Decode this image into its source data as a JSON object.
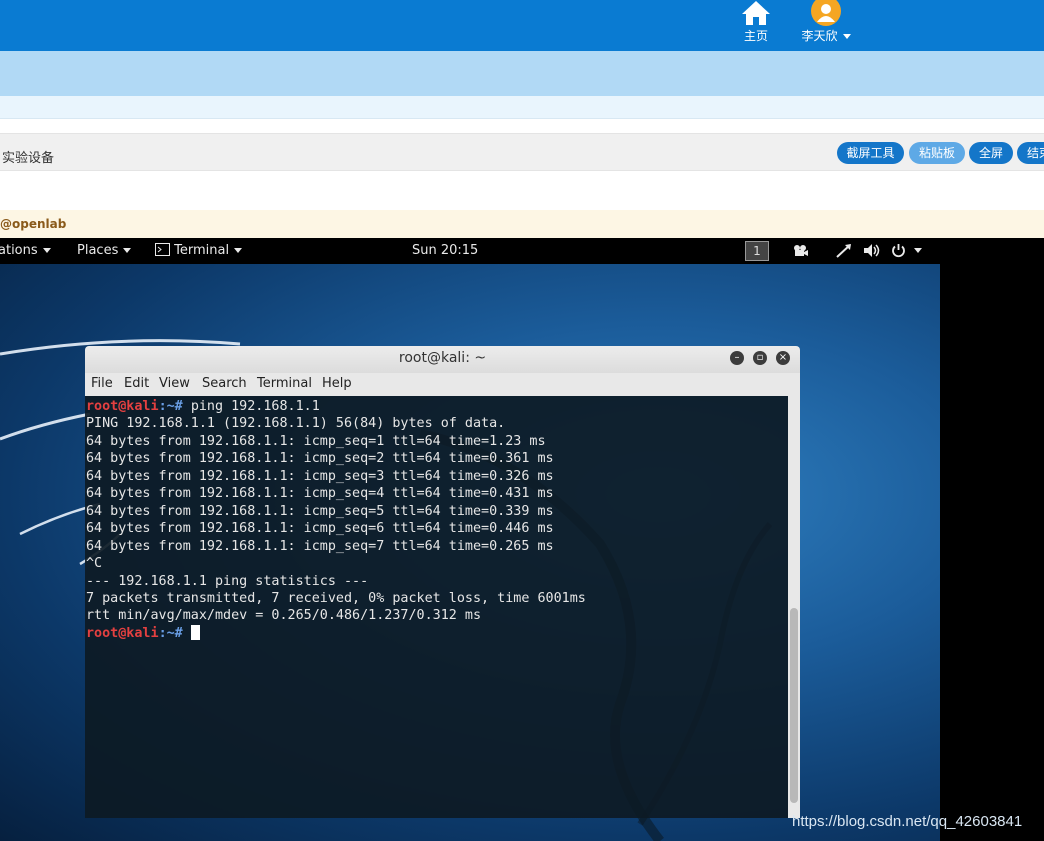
{
  "topbar": {
    "home_label": "主页",
    "user_label": "李天欣"
  },
  "toolbar": {
    "title": "实验设备",
    "buttons": [
      "截屏工具",
      "粘贴板",
      "全屏",
      "结束"
    ]
  },
  "notice": {
    "text": "@openlab"
  },
  "gnome": {
    "applications": "ations",
    "places": "Places",
    "terminal": "Terminal",
    "clock": "Sun 20:15",
    "workspace": "1"
  },
  "terminal": {
    "title": "root@kali: ~",
    "menu": [
      "File",
      "Edit",
      "View",
      "Search",
      "Terminal",
      "Help"
    ],
    "prompt_user": "root@kali",
    "prompt_path": ":~#",
    "command": "ping 192.168.1.1",
    "output": [
      "PING 192.168.1.1 (192.168.1.1) 56(84) bytes of data.",
      "64 bytes from 192.168.1.1: icmp_seq=1 ttl=64 time=1.23 ms",
      "64 bytes from 192.168.1.1: icmp_seq=2 ttl=64 time=0.361 ms",
      "64 bytes from 192.168.1.1: icmp_seq=3 ttl=64 time=0.326 ms",
      "64 bytes from 192.168.1.1: icmp_seq=4 ttl=64 time=0.431 ms",
      "64 bytes from 192.168.1.1: icmp_seq=5 ttl=64 time=0.339 ms",
      "64 bytes from 192.168.1.1: icmp_seq=6 ttl=64 time=0.446 ms",
      "64 bytes from 192.168.1.1: icmp_seq=7 ttl=64 time=0.265 ms",
      "^C",
      "--- 192.168.1.1 ping statistics ---",
      "7 packets transmitted, 7 received, 0% packet loss, time 6001ms",
      "rtt min/avg/max/mdev = 0.265/0.486/1.237/0.312 ms"
    ]
  },
  "watermark": "https://blog.csdn.net/qq_42603841",
  "colors": {
    "topbar": "#0a7bd2",
    "band": "#b1d9f5",
    "prompt": "#e34040",
    "terminal_bg": "#0d1a24"
  }
}
